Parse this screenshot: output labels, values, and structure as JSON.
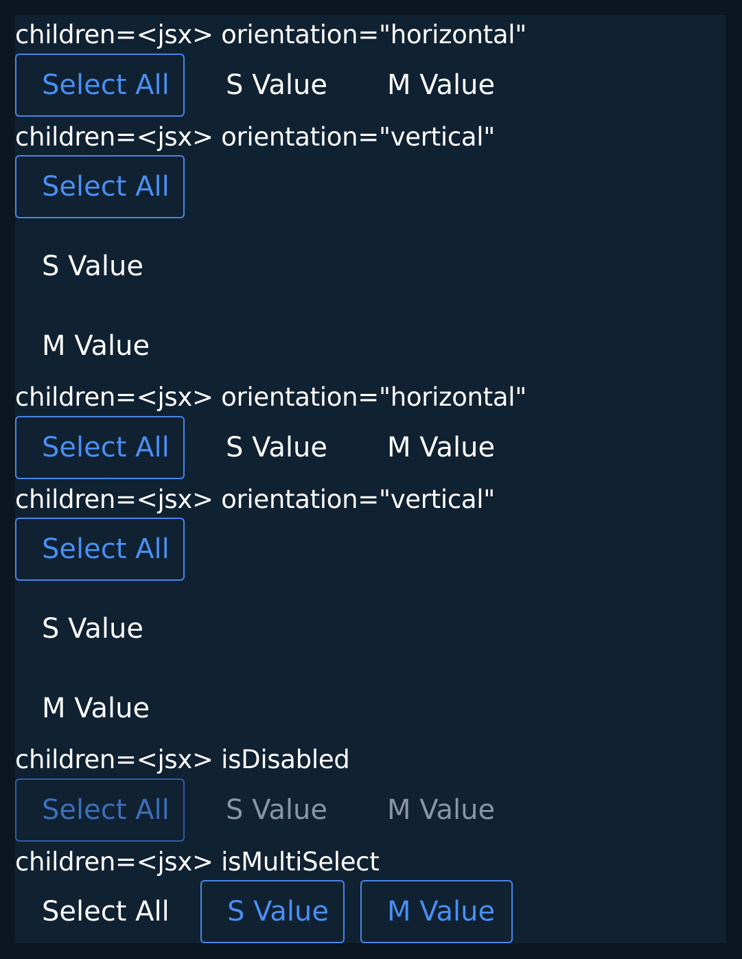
{
  "sections": [
    {
      "label": "children=<jsx> orientation=\"horizontal\"",
      "items": [
        "Select All",
        "S Value",
        "M Value"
      ]
    },
    {
      "label": "children=<jsx> orientation=\"vertical\"",
      "items": [
        "Select All",
        "S Value",
        "M Value"
      ]
    },
    {
      "label": "children=<jsx> orientation=\"horizontal\"",
      "items": [
        "Select All",
        "S Value",
        "M Value"
      ]
    },
    {
      "label": "children=<jsx> orientation=\"vertical\"",
      "items": [
        "Select All",
        "S Value",
        "M Value"
      ]
    },
    {
      "label": "children=<jsx> isDisabled",
      "items": [
        "Select All",
        "S Value",
        "M Value"
      ]
    },
    {
      "label": "children=<jsx> isMultiSelect",
      "items": [
        "Select All",
        "S Value",
        "M Value"
      ]
    }
  ],
  "colors": {
    "page_background": "#0b1620",
    "panel_background": "#102132",
    "text": "#ffffff",
    "selected_accent": "#4a86e8",
    "disabled_text": "#8a96a2"
  }
}
